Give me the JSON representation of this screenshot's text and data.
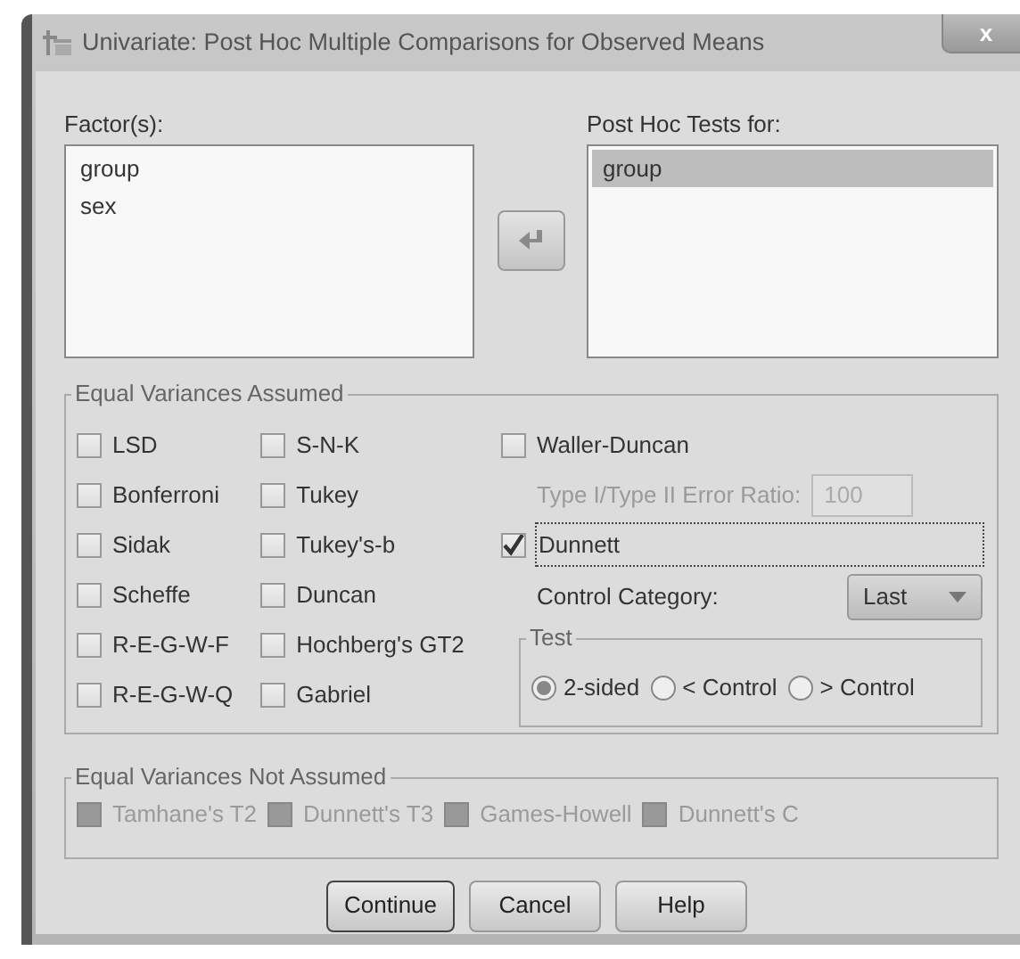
{
  "window": {
    "title": "Univariate: Post Hoc Multiple Comparisons for Observed Means",
    "close": "x"
  },
  "factors": {
    "label": "Factor(s):",
    "items": [
      {
        "text": "group",
        "selected": false
      },
      {
        "text": "sex",
        "selected": false
      }
    ]
  },
  "move_button": {
    "disabled": true
  },
  "post_hoc_tests": {
    "label": "Post Hoc Tests for:",
    "items": [
      {
        "text": "group",
        "selected": true
      }
    ]
  },
  "equal_variances_assumed": {
    "title": "Equal Variances Assumed",
    "column_1": [
      {
        "label": "LSD",
        "checked": false
      },
      {
        "label": "Bonferroni",
        "checked": false
      },
      {
        "label": "Sidak",
        "checked": false
      },
      {
        "label": "Scheffe",
        "checked": false
      },
      {
        "label": "R-E-G-W-F",
        "checked": false
      },
      {
        "label": "R-E-G-W-Q",
        "checked": false
      }
    ],
    "column_2": [
      {
        "label": "S-N-K",
        "checked": false
      },
      {
        "label": "Tukey",
        "checked": false
      },
      {
        "label": "Tukey's-b",
        "checked": false
      },
      {
        "label": "Duncan",
        "checked": false
      },
      {
        "label": "Hochberg's GT2",
        "checked": false
      },
      {
        "label": "Gabriel",
        "checked": false
      }
    ],
    "waller_duncan": {
      "label": "Waller-Duncan",
      "checked": false
    },
    "error_ratio": {
      "label": "Type I/Type II Error Ratio:",
      "value": "100",
      "disabled": true
    },
    "dunnett": {
      "label": "Dunnett",
      "checked": true,
      "focused": true
    },
    "control_category": {
      "label": "Control Category:",
      "value": "Last"
    },
    "test": {
      "title": "Test",
      "options": [
        {
          "label": "2-sided",
          "selected": true
        },
        {
          "label": "< Control",
          "selected": false
        },
        {
          "label": "> Control",
          "selected": false
        }
      ]
    }
  },
  "equal_variances_not_assumed": {
    "title": "Equal Variances Not Assumed",
    "options": [
      {
        "label": "Tamhane's T2",
        "checked": false,
        "disabled": true
      },
      {
        "label": "Dunnett's T3",
        "checked": false,
        "disabled": true
      },
      {
        "label": "Games-Howell",
        "checked": false,
        "disabled": true
      },
      {
        "label": "Dunnett's C",
        "checked": false,
        "disabled": true
      }
    ]
  },
  "buttons": [
    {
      "label": "Continue",
      "default": true
    },
    {
      "label": "Cancel",
      "default": false
    },
    {
      "label": "Help",
      "default": false
    }
  ]
}
